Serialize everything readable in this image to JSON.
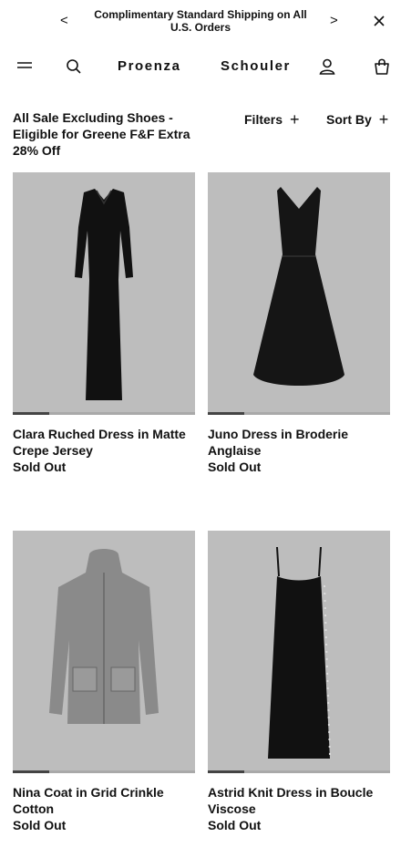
{
  "announcement": {
    "text": "Complimentary Standard Shipping on All U.S. Orders",
    "prev_icon": "chevron-left-icon",
    "next_icon": "chevron-right-icon",
    "close_icon": "close-icon"
  },
  "header": {
    "menu_icon": "hamburger-menu-icon",
    "search_icon": "search-icon",
    "brand_left": "Proenza",
    "brand_right": "Schouler",
    "account_icon": "user-icon",
    "bag_icon": "shopping-bag-icon"
  },
  "listing": {
    "title": "All Sale Excluding Shoes - Eligible for Greene F&F Extra 28% Off",
    "filters_label": "Filters",
    "sort_label": "Sort By",
    "plus_glyph": "+"
  },
  "products": [
    {
      "name": "Clara Ruched Dress in Matte Crepe Jersey",
      "status": "Sold Out",
      "image_slider_position": "1"
    },
    {
      "name": "Juno Dress in Broderie Anglaise",
      "status": "Sold Out",
      "image_slider_position": "1"
    },
    {
      "name": "Nina Coat in Grid Crinkle Cotton",
      "status": "Sold Out",
      "image_slider_position": "1"
    },
    {
      "name": "Astrid Knit Dress in Boucle Viscose",
      "status": "Sold Out",
      "image_slider_position": "1"
    }
  ],
  "colors": {
    "text": "#111111",
    "image_background": "#bdbdbd",
    "slider_track": "#a9a9a9",
    "slider_fill": "#444444"
  }
}
